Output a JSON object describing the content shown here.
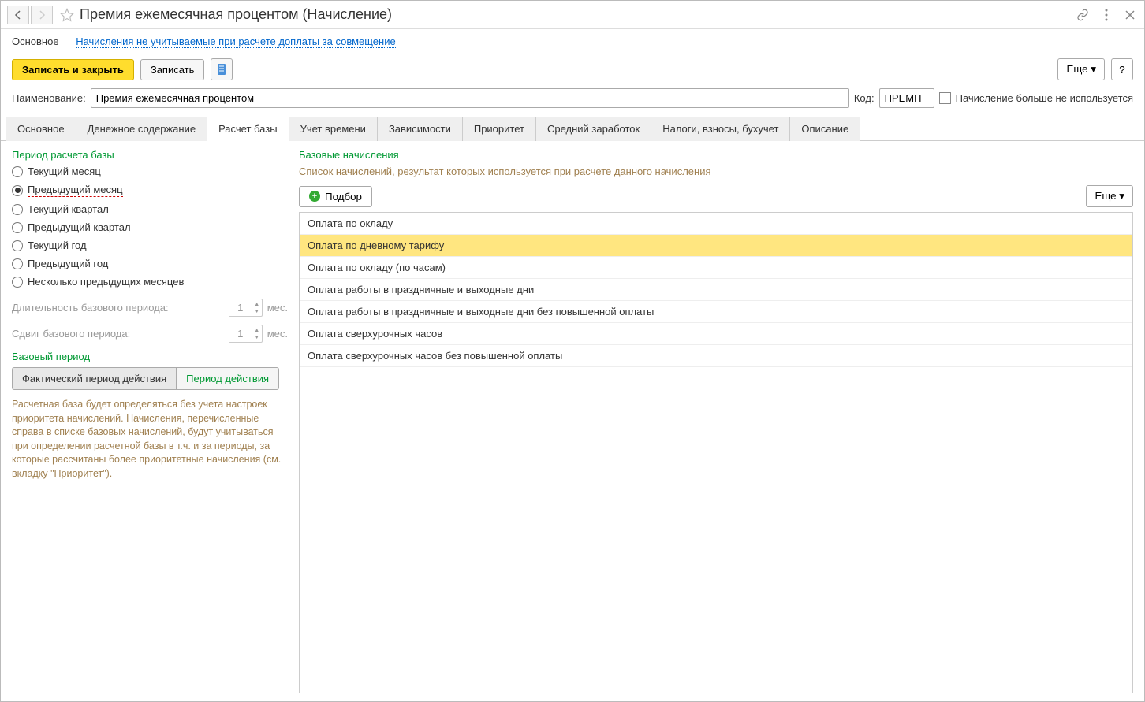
{
  "title": "Премия ежемесячная процентом (Начисление)",
  "linkbar": {
    "main": "Основное",
    "link": "Начисления не учитываемые при расчете доплаты за совмещение"
  },
  "toolbar": {
    "save_close": "Записать и закрыть",
    "save": "Записать",
    "more": "Еще",
    "help": "?"
  },
  "form": {
    "name_label": "Наименование:",
    "name_value": "Премия ежемесячная процентом",
    "code_label": "Код:",
    "code_value": "ПРЕМП",
    "unused_label": "Начисление больше не используется"
  },
  "tabs": [
    "Основное",
    "Денежное содержание",
    "Расчет базы",
    "Учет времени",
    "Зависимости",
    "Приоритет",
    "Средний заработок",
    "Налоги, взносы, бухучет",
    "Описание"
  ],
  "active_tab": 2,
  "left": {
    "period_title": "Период расчета базы",
    "radios": [
      "Текущий месяц",
      "Предыдущий месяц",
      "Текущий квартал",
      "Предыдущий квартал",
      "Текущий год",
      "Предыдущий год",
      "Несколько предыдущих месяцев"
    ],
    "selected_radio": 1,
    "duration_label": "Длительность базового периода:",
    "duration_value": "1",
    "duration_unit": "мес.",
    "shift_label": "Сдвиг базового периода:",
    "shift_value": "1",
    "shift_unit": "мес.",
    "base_title": "Базовый период",
    "toggle": [
      "Фактический период действия",
      "Период действия"
    ],
    "info": "Расчетная база будет определяться без учета настроек приоритета начислений. Начисления, перечисленные справа в списке базовых начислений, будут учитываться при определении расчетной базы в т.ч. и за периоды, за которые рассчитаны более приоритетные начисления (см. вкладку \"Приоритет\")."
  },
  "right": {
    "title": "Базовые начисления",
    "subtitle": "Список начислений, результат которых используется при расчете данного начисления",
    "add_label": "Подбор",
    "more": "Еще",
    "rows": [
      "Оплата по окладу",
      "Оплата по дневному тарифу",
      "Оплата по окладу (по часам)",
      "Оплата работы в праздничные и выходные дни",
      "Оплата работы в праздничные и выходные дни без повышенной оплаты",
      "Оплата сверхурочных часов",
      "Оплата сверхурочных часов без повышенной оплаты"
    ],
    "selected_row": 1
  }
}
